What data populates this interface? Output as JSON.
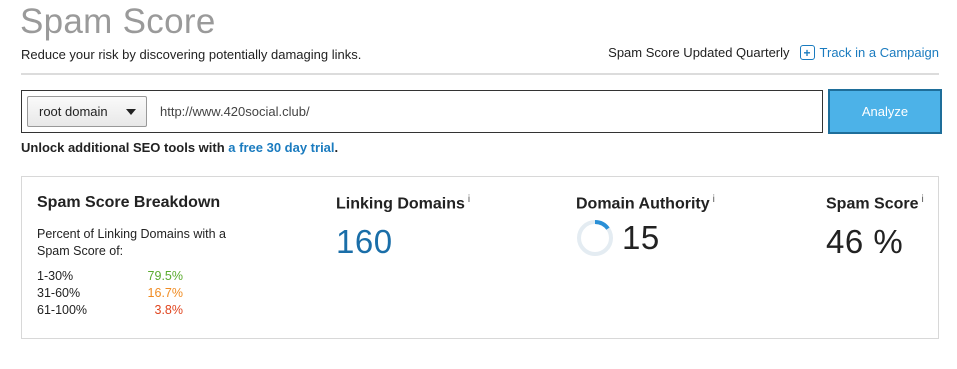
{
  "header": {
    "title": "Spam Score",
    "subtitle": "Reduce your risk by discovering potentially damaging links.",
    "updated_text": "Spam Score Updated Quarterly",
    "track_label": "Track in a Campaign",
    "track_icon": "plus-square-icon"
  },
  "search": {
    "domain_type": "root domain",
    "url": "http://www.420social.club/",
    "analyze_label": "Analyze"
  },
  "promo": {
    "prefix": "Unlock additional SEO tools with ",
    "link": "a free 30 day trial",
    "suffix": "."
  },
  "breakdown": {
    "heading": "Spam Score Breakdown",
    "description": "Percent of Linking Domains with a Spam Score of:",
    "rows": [
      {
        "range": "1-30%",
        "value": "79.5%",
        "color": "#5aab2e"
      },
      {
        "range": "31-60%",
        "value": "16.7%",
        "color": "#f08c22"
      },
      {
        "range": "61-100%",
        "value": "3.8%",
        "color": "#e0451f"
      }
    ]
  },
  "metrics": {
    "linking_domains": {
      "label": "Linking Domains",
      "info": "i",
      "value": "160"
    },
    "domain_authority": {
      "label": "Domain Authority",
      "info": "i",
      "value": "15",
      "gauge_fraction": 0.15,
      "gauge_color": "#2a8fd6",
      "gauge_track_color": "#e4ecf2"
    },
    "spam_score": {
      "label": "Spam Score",
      "info": "i",
      "value": "46 %"
    }
  }
}
